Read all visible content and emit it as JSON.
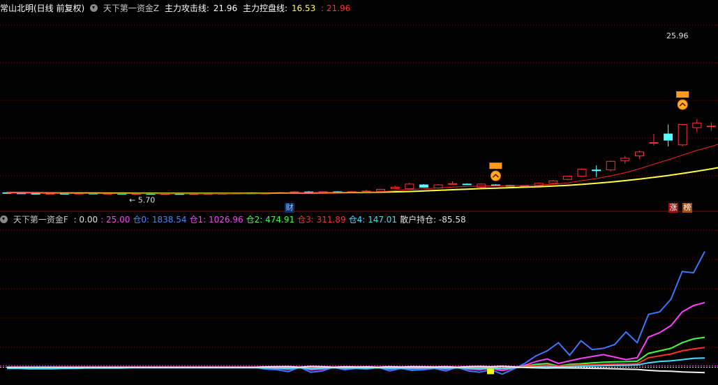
{
  "main_header": {
    "stock": "常山北明(日线 前复权)",
    "indicator": "天下第一资金Z",
    "attack_label": "主力攻击线:",
    "attack_value": "21.96",
    "control_label": "主力控盘线:",
    "control_value": "16.53",
    "extra_value": ": 21.96"
  },
  "sub_header": {
    "indicator": "天下第一资金F",
    "items": [
      {
        "label": ": 0.00",
        "color": "#e0e0e0"
      },
      {
        "label": ": 25.00",
        "color": "#ff40ff"
      },
      {
        "label": "仓0: 1838.54",
        "color": "#4a86ff"
      },
      {
        "label": "仓1: 1026.96",
        "color": "#ff40ff"
      },
      {
        "label": "仓2: 474.91",
        "color": "#40ff40"
      },
      {
        "label": "仓3: 311.89",
        "color": "#ff3030"
      },
      {
        "label": "仓4: 147.01",
        "color": "#40e0ff"
      },
      {
        "label": "散户持仓: -85.58",
        "color": "#e0e0e0"
      }
    ]
  },
  "annotations": {
    "high_label": "25.96",
    "low_label": "5.70",
    "badge_cai": "财",
    "badge_zhang": "涨",
    "badge_bang": "榜"
  },
  "colors": {
    "up": "#ff3232",
    "down": "#54ffff",
    "attack": "#ff2020",
    "control": "#ffff40",
    "grid": "#800000"
  },
  "chart_data": [
    {
      "type": "candlestick",
      "title": "天下第一资金Z",
      "ylim": [
        4.5,
        28
      ],
      "candles": [
        {
          "o": 5.9,
          "h": 6.0,
          "l": 5.8,
          "c": 5.85
        },
        {
          "o": 5.85,
          "h": 5.95,
          "l": 5.75,
          "c": 5.8
        },
        {
          "o": 5.8,
          "h": 5.9,
          "l": 5.7,
          "c": 5.75
        },
        {
          "o": 5.75,
          "h": 5.85,
          "l": 5.7,
          "c": 5.8
        },
        {
          "o": 5.8,
          "h": 5.9,
          "l": 5.72,
          "c": 5.78
        },
        {
          "o": 5.78,
          "h": 5.88,
          "l": 5.72,
          "c": 5.82
        },
        {
          "o": 5.82,
          "h": 5.9,
          "l": 5.74,
          "c": 5.76
        },
        {
          "o": 5.76,
          "h": 5.84,
          "l": 5.7,
          "c": 5.8
        },
        {
          "o": 5.8,
          "h": 5.88,
          "l": 5.72,
          "c": 5.74
        },
        {
          "o": 5.74,
          "h": 5.82,
          "l": 5.7,
          "c": 5.78
        },
        {
          "o": 5.78,
          "h": 5.86,
          "l": 5.72,
          "c": 5.74
        },
        {
          "o": 5.74,
          "h": 5.8,
          "l": 5.7,
          "c": 5.76
        },
        {
          "o": 5.76,
          "h": 5.84,
          "l": 5.7,
          "c": 5.72
        },
        {
          "o": 5.72,
          "h": 5.8,
          "l": 5.68,
          "c": 5.76
        },
        {
          "o": 5.76,
          "h": 5.86,
          "l": 5.72,
          "c": 5.8
        },
        {
          "o": 5.8,
          "h": 5.9,
          "l": 5.74,
          "c": 5.82
        },
        {
          "o": 5.82,
          "h": 5.9,
          "l": 5.76,
          "c": 5.86
        },
        {
          "o": 5.86,
          "h": 5.94,
          "l": 5.78,
          "c": 5.8
        },
        {
          "o": 5.8,
          "h": 5.9,
          "l": 5.74,
          "c": 5.84
        },
        {
          "o": 5.84,
          "h": 5.98,
          "l": 5.78,
          "c": 5.9
        },
        {
          "o": 5.9,
          "h": 6.1,
          "l": 5.84,
          "c": 6.0
        },
        {
          "o": 6.0,
          "h": 6.1,
          "l": 5.9,
          "c": 5.92
        },
        {
          "o": 5.92,
          "h": 6.05,
          "l": 5.86,
          "c": 6.02
        },
        {
          "o": 6.02,
          "h": 6.1,
          "l": 5.94,
          "c": 5.98
        },
        {
          "o": 5.98,
          "h": 6.08,
          "l": 5.92,
          "c": 6.04
        },
        {
          "o": 6.05,
          "h": 6.3,
          "l": 6.0,
          "c": 6.1
        },
        {
          "o": 6.1,
          "h": 6.4,
          "l": 6.0,
          "c": 6.32
        },
        {
          "o": 6.4,
          "h": 6.8,
          "l": 6.35,
          "c": 6.6
        },
        {
          "o": 6.4,
          "h": 7.2,
          "l": 6.3,
          "c": 7.0
        },
        {
          "o": 6.9,
          "h": 7.0,
          "l": 6.5,
          "c": 6.6
        },
        {
          "o": 6.5,
          "h": 7.0,
          "l": 6.4,
          "c": 6.9
        },
        {
          "o": 7.05,
          "h": 7.35,
          "l": 6.95,
          "c": 7.05
        },
        {
          "o": 7.0,
          "h": 7.1,
          "l": 6.9,
          "c": 6.95
        },
        {
          "o": 6.6,
          "h": 7.1,
          "l": 6.5,
          "c": 7.0
        },
        {
          "o": 6.9,
          "h": 7.0,
          "l": 6.8,
          "c": 6.85
        },
        {
          "o": 6.82,
          "h": 6.9,
          "l": 6.7,
          "c": 6.75
        },
        {
          "o": 6.75,
          "h": 6.85,
          "l": 6.65,
          "c": 6.8
        },
        {
          "o": 6.8,
          "h": 7.2,
          "l": 6.7,
          "c": 7.1
        },
        {
          "o": 7.1,
          "h": 7.5,
          "l": 7.0,
          "c": 7.4
        },
        {
          "o": 7.6,
          "h": 8.0,
          "l": 7.5,
          "c": 8.0
        },
        {
          "o": 8.0,
          "h": 9.0,
          "l": 7.9,
          "c": 8.9
        },
        {
          "o": 8.8,
          "h": 9.4,
          "l": 7.9,
          "c": 8.7
        },
        {
          "o": 8.8,
          "h": 10.0,
          "l": 8.6,
          "c": 9.9
        },
        {
          "o": 10.0,
          "h": 10.6,
          "l": 9.6,
          "c": 10.3
        },
        {
          "o": 10.6,
          "h": 11.3,
          "l": 10.2,
          "c": 11.1
        },
        {
          "o": 12.3,
          "h": 13.4,
          "l": 11.9,
          "c": 12.3
        },
        {
          "o": 13.4,
          "h": 14.6,
          "l": 11.8,
          "c": 12.6
        },
        {
          "o": 12.0,
          "h": 14.6,
          "l": 11.8,
          "c": 14.6
        },
        {
          "o": 14.2,
          "h": 15.3,
          "l": 13.6,
          "c": 14.8
        },
        {
          "o": 14.4,
          "h": 14.9,
          "l": 13.8,
          "c": 14.4
        },
        {
          "o": 14.2,
          "h": 15.3,
          "l": 14.0,
          "c": 15.2
        },
        {
          "o": 16.8,
          "h": 16.9,
          "l": 16.7,
          "c": 16.8
        },
        {
          "o": 18.5,
          "h": 18.7,
          "l": 18.3,
          "c": 18.5
        },
        {
          "o": 19.1,
          "h": 19.1,
          "l": 16.2,
          "c": 18.8
        },
        {
          "o": 17.0,
          "h": 19.1,
          "l": 16.6,
          "c": 19.0
        },
        {
          "o": 18.6,
          "h": 21.1,
          "l": 18.3,
          "c": 21.0
        },
        {
          "o": 21.0,
          "h": 22.8,
          "l": 20.8,
          "c": 22.6
        },
        {
          "o": 22.6,
          "h": 24.7,
          "l": 22.2,
          "c": 24.6
        },
        {
          "o": 24.7,
          "h": 25.6,
          "l": 22.7,
          "c": 24.9
        },
        {
          "o": 24.9,
          "h": 25.96,
          "l": 22.9,
          "c": 24.8
        }
      ],
      "attack_line": [
        5.9,
        5.88,
        5.86,
        5.84,
        5.83,
        5.82,
        5.82,
        5.81,
        5.8,
        5.8,
        5.79,
        5.79,
        5.78,
        5.78,
        5.78,
        5.79,
        5.8,
        5.8,
        5.81,
        5.83,
        5.86,
        5.88,
        5.9,
        5.92,
        5.94,
        5.98,
        6.04,
        6.15,
        6.3,
        6.4,
        6.5,
        6.62,
        6.7,
        6.75,
        6.78,
        6.8,
        6.82,
        6.88,
        6.98,
        7.15,
        7.45,
        7.7,
        8.05,
        8.45,
        8.95,
        9.55,
        10.1,
        10.7,
        11.3,
        11.8,
        12.4,
        13.1,
        13.9,
        14.6,
        15.3,
        16.2,
        17.2,
        18.3,
        19.5,
        20.6
      ],
      "control_line": [
        5.9,
        5.9,
        5.88,
        5.87,
        5.86,
        5.85,
        5.85,
        5.84,
        5.84,
        5.83,
        5.83,
        5.82,
        5.82,
        5.82,
        5.82,
        5.82,
        5.82,
        5.83,
        5.83,
        5.84,
        5.85,
        5.86,
        5.88,
        5.9,
        5.92,
        5.94,
        5.97,
        6.0,
        6.05,
        6.12,
        6.2,
        6.28,
        6.35,
        6.42,
        6.48,
        6.54,
        6.6,
        6.66,
        6.74,
        6.84,
        6.96,
        7.1,
        7.26,
        7.44,
        7.64,
        7.86,
        8.1,
        8.36,
        8.64,
        8.94,
        9.26,
        9.6,
        10.0,
        10.45,
        11.0,
        11.6,
        12.35,
        13.2,
        14.2,
        15.3
      ]
    },
    {
      "type": "line",
      "title": "天下第一资金F",
      "ylim": [
        -150,
        2200
      ],
      "series": [
        {
          "name": "仓0",
          "color": "#3a78ff",
          "values": [
            0,
            0,
            -15,
            -15,
            -10,
            0,
            0,
            0,
            0,
            0,
            0,
            0,
            0,
            0,
            0,
            0,
            0,
            0,
            0,
            0,
            0,
            0,
            0,
            -30,
            -40,
            -70,
            0,
            -80,
            -60,
            0,
            -40,
            -20,
            -30,
            0,
            -60,
            -20,
            -50,
            -40,
            -20,
            -60,
            0,
            -60,
            -80,
            -40,
            -110,
            -30,
            60,
            180,
            260,
            390,
            190,
            420,
            280,
            300,
            360,
            560,
            390,
            840,
            880,
            1080,
            1520,
            1500,
            1838.54
          ]
        },
        {
          "name": "仓1",
          "color": "#ff40ff",
          "values": [
            0,
            0,
            0,
            0,
            0,
            0,
            0,
            0,
            0,
            0,
            0,
            0,
            0,
            0,
            0,
            0,
            0,
            0,
            0,
            0,
            0,
            0,
            0,
            -10,
            -20,
            -35,
            0,
            -40,
            -30,
            0,
            -20,
            -10,
            -15,
            0,
            -30,
            -10,
            -25,
            -20,
            -10,
            -30,
            0,
            -30,
            -40,
            -20,
            -55,
            -15,
            30,
            90,
            130,
            60,
            100,
            140,
            170,
            200,
            160,
            120,
            150,
            480,
            550,
            660,
            880,
            980,
            1026.96
          ]
        },
        {
          "name": "仓2",
          "color": "#40ff40",
          "values": [
            0,
            0,
            0,
            0,
            0,
            0,
            0,
            0,
            0,
            0,
            0,
            0,
            0,
            0,
            0,
            0,
            0,
            0,
            0,
            0,
            0,
            0,
            0,
            -5,
            -10,
            -15,
            0,
            -20,
            -15,
            0,
            -10,
            -5,
            -8,
            0,
            -15,
            -5,
            -12,
            -10,
            -5,
            -15,
            0,
            -15,
            -20,
            -10,
            -25,
            -8,
            15,
            45,
            60,
            20,
            45,
            55,
            70,
            80,
            85,
            88,
            95,
            220,
            260,
            300,
            390,
            450,
            474.91
          ]
        },
        {
          "name": "仓3",
          "color": "#ff3030",
          "values": [
            0,
            0,
            0,
            0,
            0,
            0,
            0,
            0,
            0,
            0,
            0,
            0,
            0,
            0,
            0,
            0,
            0,
            0,
            0,
            0,
            0,
            0,
            0,
            -3,
            -6,
            -10,
            0,
            -12,
            -9,
            0,
            -6,
            -3,
            -5,
            0,
            -9,
            -3,
            -7,
            -6,
            -3,
            -9,
            0,
            -9,
            -12,
            -6,
            -15,
            -5,
            10,
            25,
            35,
            20,
            30,
            35,
            40,
            45,
            48,
            50,
            55,
            150,
            180,
            210,
            260,
            290,
            311.89
          ]
        },
        {
          "name": "仓4",
          "color": "#40e0ff",
          "values": [
            -20,
            -20,
            -25,
            -25,
            -25,
            -20,
            -20,
            -15,
            -15,
            -15,
            -15,
            -10,
            -10,
            -10,
            -10,
            -10,
            -10,
            -10,
            -10,
            -10,
            -10,
            -10,
            -10,
            -12,
            -15,
            -18,
            -10,
            -20,
            -15,
            -10,
            -15,
            -12,
            -14,
            -10,
            -16,
            -12,
            -14,
            -12,
            -10,
            -14,
            -10,
            -14,
            -16,
            -12,
            -18,
            -10,
            0,
            5,
            10,
            5,
            10,
            15,
            20,
            25,
            28,
            30,
            35,
            70,
            90,
            100,
            120,
            140,
            147.01
          ]
        },
        {
          "name": "散户持仓",
          "color": "#f0f0f0",
          "values": [
            0,
            0,
            0,
            0,
            0,
            0,
            0,
            0,
            0,
            0,
            0,
            0,
            0,
            0,
            0,
            0,
            0,
            0,
            0,
            0,
            0,
            0,
            0,
            5,
            8,
            10,
            0,
            12,
            9,
            0,
            6,
            3,
            5,
            0,
            9,
            3,
            7,
            6,
            3,
            9,
            0,
            9,
            12,
            6,
            15,
            5,
            -5,
            -10,
            -15,
            -10,
            -12,
            -15,
            -18,
            -20,
            -25,
            -30,
            -35,
            -50,
            -60,
            -65,
            -75,
            -80,
            -85.58
          ]
        }
      ],
      "ref_lines": [
        {
          "value": 0,
          "color": "#e0e0e0"
        },
        {
          "value": 25,
          "color": "#ff40ff"
        }
      ]
    }
  ]
}
